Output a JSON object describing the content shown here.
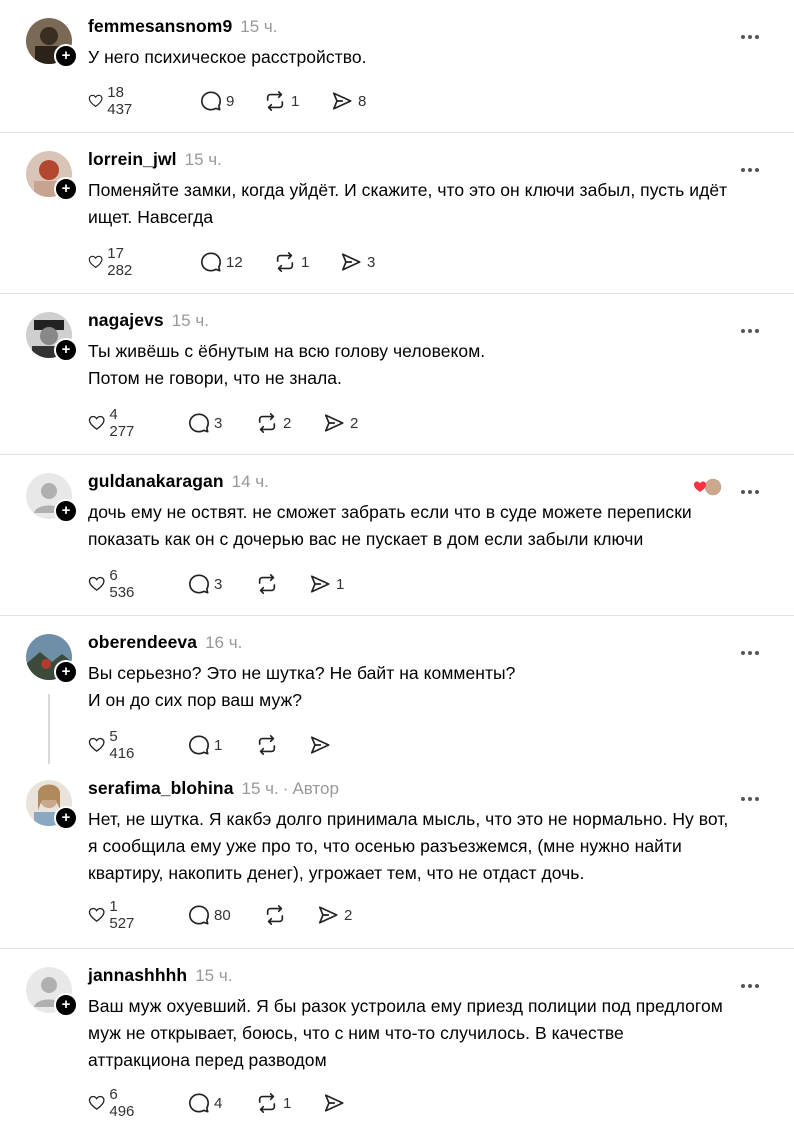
{
  "posts": [
    {
      "username": "femmesansnom9",
      "time": "15 ч.",
      "lines": [
        "У него психическое расстройство."
      ],
      "likes": "18 437",
      "replies": "9",
      "reposts": "1",
      "shares": "8"
    },
    {
      "username": "lorrein_jwl",
      "time": "15 ч.",
      "lines": [
        "Поменяйте замки, когда уйдёт. И скажите, что это он ключи забыл, пусть идёт",
        "ищет. Навсегда"
      ],
      "likes": "17 282",
      "replies": "12",
      "reposts": "1",
      "shares": "3"
    },
    {
      "username": "nagajevs",
      "time": "15 ч.",
      "lines": [
        "Ты живёшь с ёбнутым на всю голову человеком.",
        "Потом не говори, что не знала."
      ],
      "likes": "4 277",
      "replies": "3",
      "reposts": "2",
      "shares": "2"
    },
    {
      "username": "guldanakaragan",
      "time": "14 ч.",
      "lines": [
        "дочь ему не оствят. не сможет забрать если что в суде можете переписки",
        "показать как он с дочерью вас не пускает в дом если забыли ключи"
      ],
      "likes": "6 536",
      "replies": "3",
      "reposts": "",
      "shares": "1"
    },
    {
      "username": "oberendeeva",
      "time": "16 ч.",
      "lines": [
        "Вы серьезно? Это не шутка? Не байт на комменты?",
        "И он до сих пор ваш муж?"
      ],
      "likes": "5 416",
      "replies": "1",
      "reposts": "",
      "shares": ""
    },
    {
      "username": "serafima_blohina",
      "time": "15 ч.",
      "author_label": "Автор",
      "lines": [
        "Нет, не шутка. Я какбэ долго принимала мысль, что это не нормально. Ну вот,",
        "я сообщила ему уже про то, что осенью разъезжемся, (мне нужно найти",
        "квартиру, накопить денег), угрожает тем, что не отдаст дочь."
      ],
      "likes": "1 527",
      "replies": "80",
      "reposts": "",
      "shares": "2"
    },
    {
      "username": "jannashhhh",
      "time": "15 ч.",
      "lines": [
        "Ваш муж охуевший. Я бы разок устроила ему приезд полиции под предлогом",
        "муж не открывает, боюсь, что с ним что-то случилось. В качестве",
        "аттракциона перед разводом"
      ],
      "likes": "6 496",
      "replies": "4",
      "reposts": "1",
      "shares": ""
    }
  ],
  "icons": {
    "more": "more-icon",
    "like": "heart-icon",
    "reply": "comment-icon",
    "repost": "repost-icon",
    "share": "share-icon",
    "follow": "plus-icon",
    "liked_by_author": "heart-liked-icon"
  },
  "colors": {
    "liked_heart": "#ff3040",
    "muted": "#999999"
  }
}
